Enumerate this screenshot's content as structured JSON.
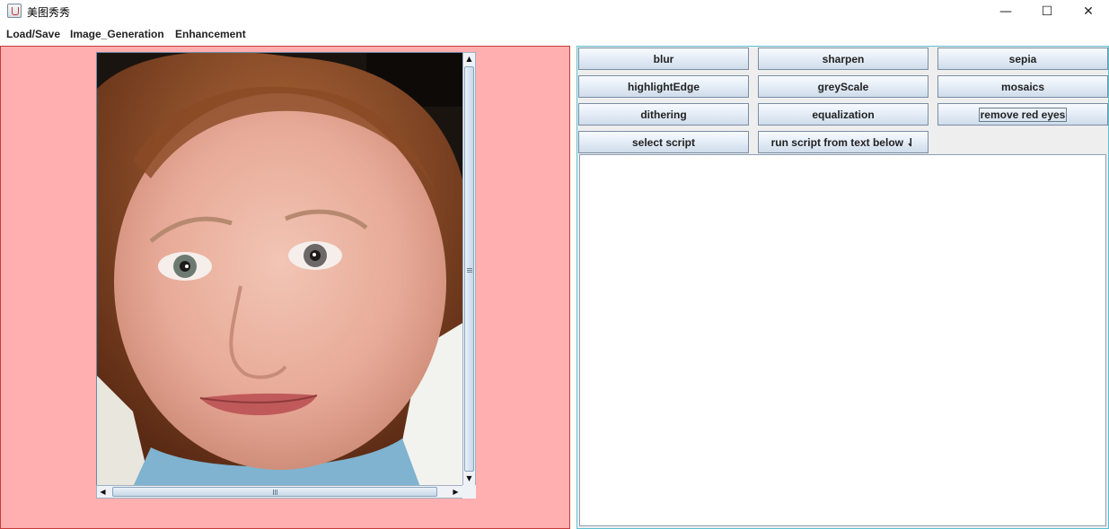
{
  "window": {
    "title": "美图秀秀",
    "controls": {
      "minimize": "—",
      "maximize": "☐",
      "close": "✕"
    }
  },
  "menu": [
    "Load/Save",
    "Image_Generation",
    "Enhancement"
  ],
  "buttons": [
    "blur",
    "sharpen",
    "sepia",
    "highlightEdge",
    "greyScale",
    "mosaics",
    "dithering",
    "equalization",
    "remove red eyes",
    "select script",
    "run script from text below ⇃"
  ],
  "script_text": "",
  "colors": {
    "left_panel_bg": "#ffafaf",
    "left_panel_border": "#c63b3b",
    "right_panel_border": "#5bc0d0"
  },
  "icons": {
    "app": "java-cup-icon",
    "scroll_up": "▲",
    "scroll_down": "▼",
    "scroll_left": "◀",
    "scroll_right": "▶"
  }
}
